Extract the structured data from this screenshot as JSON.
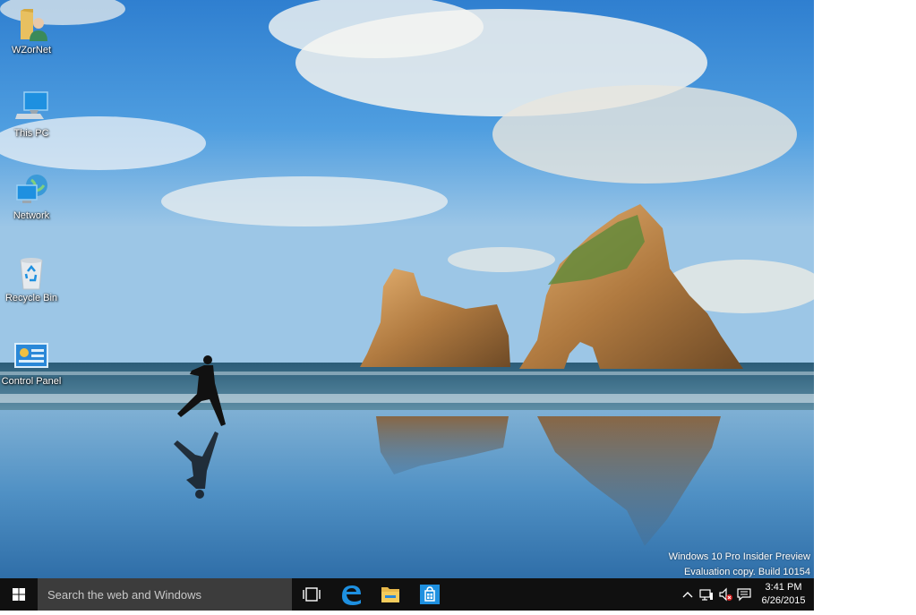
{
  "desktop": {
    "icons": [
      {
        "label": "WZorNet",
        "icon": "user-folder-icon"
      },
      {
        "label": "This PC",
        "icon": "computer-icon"
      },
      {
        "label": "Network",
        "icon": "network-icon"
      },
      {
        "label": "Recycle Bin",
        "icon": "recycle-bin-icon"
      },
      {
        "label": "Control Panel",
        "icon": "control-panel-icon"
      }
    ],
    "watermark": {
      "line1": "Windows 10 Pro Insider Preview",
      "line2": "Evaluation copy. Build 10154"
    }
  },
  "taskbar": {
    "start_icon": "windows-logo-icon",
    "search_placeholder": "Search the web and Windows",
    "pinned": [
      {
        "icon": "task-view-icon"
      },
      {
        "icon": "edge-browser-icon"
      },
      {
        "icon": "file-explorer-icon"
      },
      {
        "icon": "store-icon"
      }
    ],
    "tray": {
      "icons": [
        "chevron-up-icon",
        "network-icon",
        "volume-muted-icon",
        "action-center-icon"
      ],
      "time": "3:41 PM",
      "date": "6/26/2015"
    }
  },
  "colors": {
    "taskbar_bg": "#101010",
    "search_bg": "#3c3c3c",
    "accent": "#1e90e0"
  }
}
